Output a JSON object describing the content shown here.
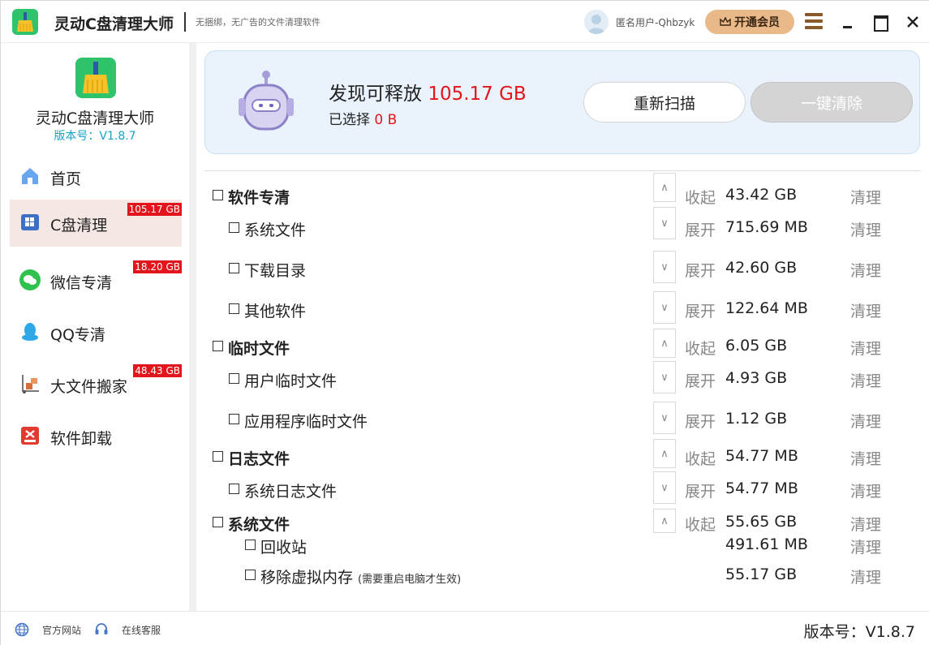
{
  "titlebar": {
    "app_title": "灵动C盘清理大师",
    "subtitle": "无捆绑，无广告的文件清理软件",
    "username": "匿名用户-Qhbzyk",
    "vip_label": "开通会员"
  },
  "sidebar": {
    "brand_name": "灵动C盘清理大师",
    "brand_version": "版本号：V1.8.7",
    "items": [
      {
        "label": "首页",
        "badge": ""
      },
      {
        "label": "C盘清理",
        "badge": "105.17 GB"
      },
      {
        "label": "微信专清",
        "badge": "18.20 GB"
      },
      {
        "label": "QQ专清",
        "badge": ""
      },
      {
        "label": "大文件搬家",
        "badge": "48.43 GB"
      },
      {
        "label": "软件卸载",
        "badge": ""
      }
    ]
  },
  "hero": {
    "found_prefix": "发现可释放",
    "found_size": "105.17 GB",
    "selected_prefix": "已选择",
    "selected_size": "0 B",
    "rescan_label": "重新扫描",
    "clean_all_label": "一键清除"
  },
  "rows": [
    {
      "name": "软件专清",
      "toggle_symbol": "∧",
      "toggle_label": "收起",
      "size": "43.42 GB",
      "clean": "清理"
    },
    {
      "name": "系统文件",
      "toggle_symbol": "∨",
      "toggle_label": "展开",
      "size": "715.69 MB",
      "clean": "清理"
    },
    {
      "name": "下载目录",
      "toggle_symbol": "∨",
      "toggle_label": "展开",
      "size": "42.60 GB",
      "clean": "清理"
    },
    {
      "name": "其他软件",
      "toggle_symbol": "∨",
      "toggle_label": "展开",
      "size": "122.64 MB",
      "clean": "清理"
    },
    {
      "name": "临时文件",
      "toggle_symbol": "∧",
      "toggle_label": "收起",
      "size": "6.05 GB",
      "clean": "清理"
    },
    {
      "name": "用户临时文件",
      "toggle_symbol": "∨",
      "toggle_label": "展开",
      "size": "4.93 GB",
      "clean": "清理"
    },
    {
      "name": "应用程序临时文件",
      "toggle_symbol": "∨",
      "toggle_label": "展开",
      "size": "1.12 GB",
      "clean": "清理"
    },
    {
      "name": "日志文件",
      "toggle_symbol": "∧",
      "toggle_label": "收起",
      "size": "54.77 MB",
      "clean": "清理"
    },
    {
      "name": "系统日志文件",
      "toggle_symbol": "∨",
      "toggle_label": "展开",
      "size": "54.77 MB",
      "clean": "清理"
    },
    {
      "name": "系统文件",
      "toggle_symbol": "∧",
      "toggle_label": "收起",
      "size": "55.65 GB",
      "clean": "清理"
    },
    {
      "name": "回收站",
      "size": "491.61 MB",
      "clean": "清理"
    },
    {
      "name": "移除虚拟内存",
      "note": "(需要重启电脑才生效)",
      "size": "55.17 GB",
      "clean": "清理"
    }
  ],
  "footer": {
    "website_label": "官方网站",
    "support_label": "在线客服",
    "version_label": "版本号：V1.8.7"
  },
  "colors": {
    "accent_red": "#e3141b",
    "version_cyan": "#19a3c9",
    "vip_gold": "#e9b98a",
    "hero_bg": "#eaf3fc",
    "active_nav_bg": "#f5e8e4"
  },
  "icons": {
    "app": "broom-app-icon",
    "home": "home-icon",
    "c_drive": "windows-drive-icon",
    "wechat": "wechat-icon",
    "qq": "qq-penguin-icon",
    "big_file": "moving-boxes-icon",
    "uninstall": "uninstall-icon",
    "menu": "hamburger-menu-icon",
    "website": "globe-icon",
    "support": "headset-icon"
  }
}
